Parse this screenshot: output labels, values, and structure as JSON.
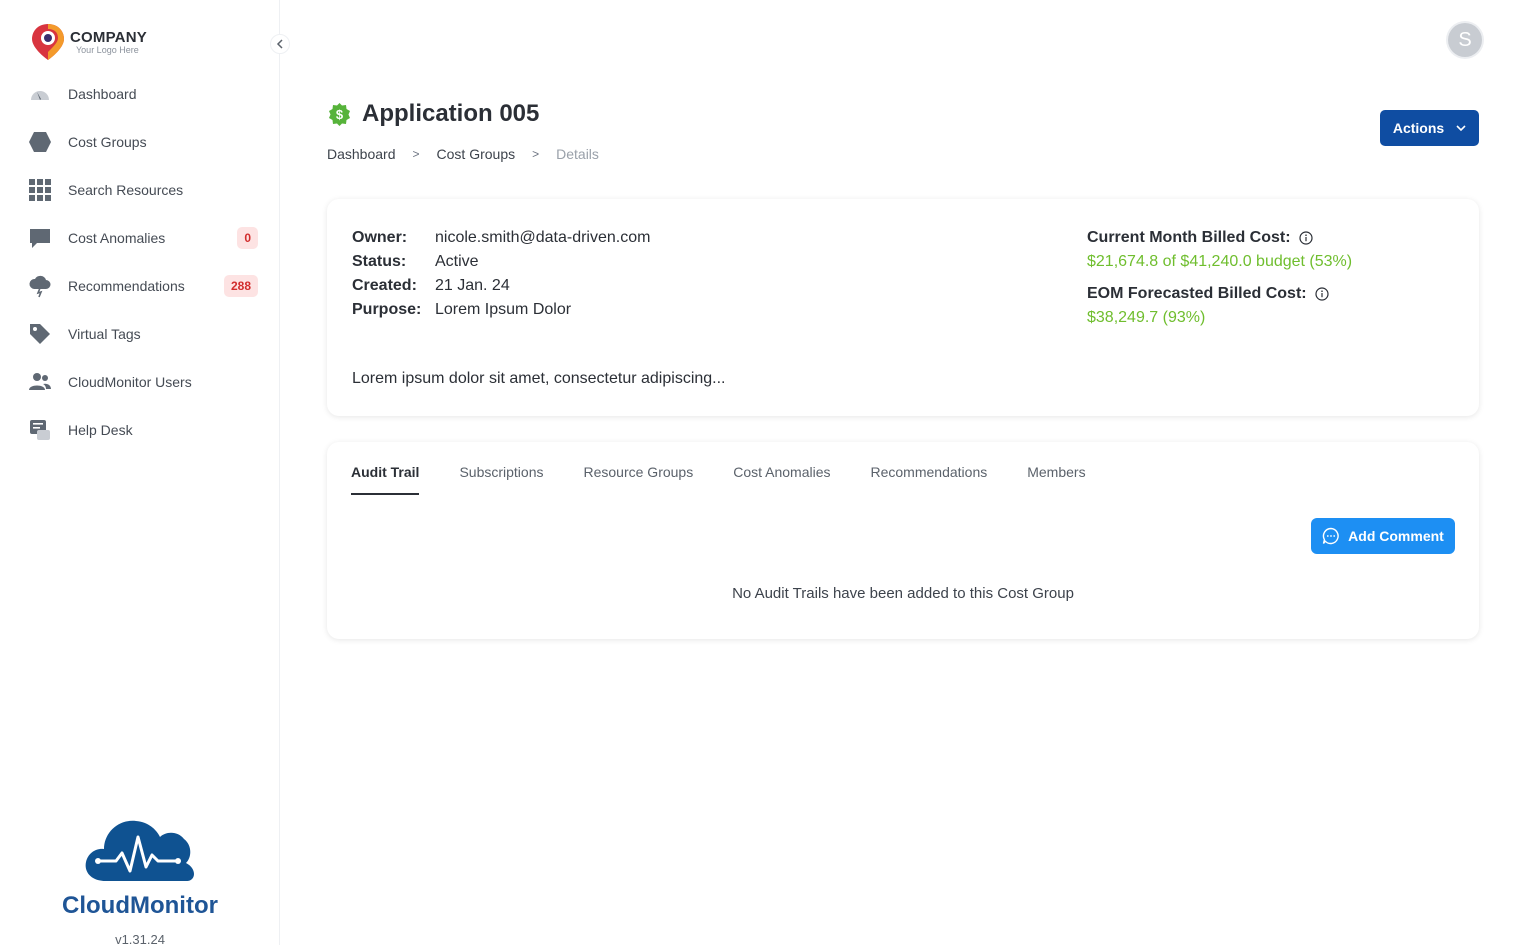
{
  "logo": {
    "name": "COMPANY",
    "tagline": "Your Logo Here"
  },
  "sidebar": {
    "items": [
      {
        "label": "Dashboard",
        "icon": "gauge-icon",
        "badge": null
      },
      {
        "label": "Cost Groups",
        "icon": "hexagon-icon",
        "badge": null
      },
      {
        "label": "Search Resources",
        "icon": "grid-icon",
        "badge": null
      },
      {
        "label": "Cost Anomalies",
        "icon": "chat-bubble-icon",
        "badge": "0"
      },
      {
        "label": "Recommendations",
        "icon": "cloud-bolt-icon",
        "badge": "288"
      },
      {
        "label": "Virtual Tags",
        "icon": "tag-icon",
        "badge": null
      },
      {
        "label": "CloudMonitor Users",
        "icon": "users-icon",
        "badge": null
      },
      {
        "label": "Help Desk",
        "icon": "help-desk-icon",
        "badge": null
      }
    ]
  },
  "brand": {
    "name": "CloudMonitor",
    "version": "v1.31.24"
  },
  "user": {
    "initial": "S"
  },
  "page": {
    "title": "Application 005"
  },
  "breadcrumb": {
    "items": [
      "Dashboard",
      "Cost Groups",
      "Details"
    ],
    "separator": ">"
  },
  "actions": {
    "label": "Actions"
  },
  "details": {
    "owner_label": "Owner:",
    "owner": "nicole.smith@data-driven.com",
    "status_label": "Status:",
    "status": "Active",
    "created_label": "Created:",
    "created": "21 Jan. 24",
    "purpose_label": "Purpose:",
    "purpose": "Lorem Ipsum Dolor",
    "description": "Lorem ipsum dolor sit amet, consectetur adipiscing..."
  },
  "costs": {
    "current_label": "Current Month Billed Cost:",
    "current_value": "$21,674.8 of $41,240.0 budget (53%)",
    "forecast_label": "EOM Forecasted Billed Cost:",
    "forecast_value": "$38,249.7 (93%)"
  },
  "tabs": [
    "Audit Trail",
    "Subscriptions",
    "Resource Groups",
    "Cost Anomalies",
    "Recommendations",
    "Members"
  ],
  "audit": {
    "add_label": "Add Comment",
    "empty": "No Audit Trails have been added to this Cost Group"
  },
  "colors": {
    "primary": "#0f4da2",
    "accent": "#1d8ff3",
    "success": "#6fbe2e",
    "badge_bg": "#fde3e3",
    "badge_text": "#d22d2d",
    "brand": "#1f5596"
  }
}
